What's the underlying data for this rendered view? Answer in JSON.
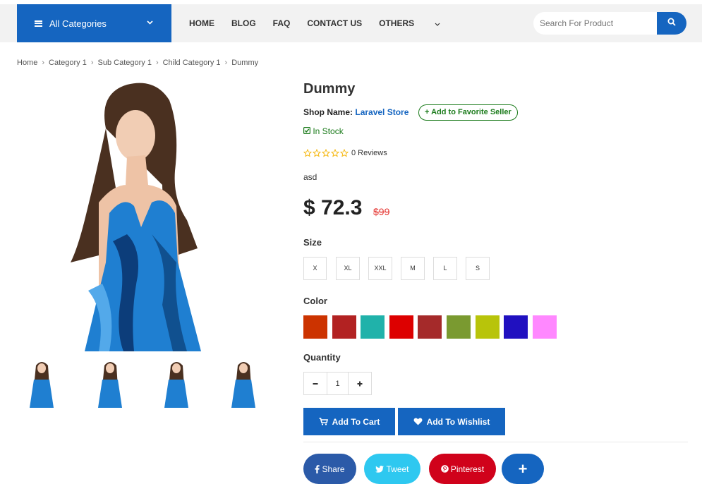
{
  "nav": {
    "all_categories": "All Categories",
    "menu": [
      "HOME",
      "BLOG",
      "FAQ",
      "CONTACT US",
      "OTHERS"
    ],
    "search_placeholder": "Search For Product"
  },
  "breadcrumb": [
    "Home",
    "Category 1",
    "Sub Category 1",
    "Child Category 1",
    "Dummy"
  ],
  "product": {
    "title": "Dummy",
    "shop_label": "Shop Name:",
    "shop_name": "Laravel Store",
    "favorite_label": "Add to Favorite Seller",
    "stock": "In Stock",
    "reviews": "0 Reviews",
    "rating_stars": 0,
    "description": "asd",
    "price": "$ 72.3",
    "old_price": "$99",
    "size_label": "Size",
    "sizes": [
      "X",
      "XL",
      "XXL",
      "M",
      "L",
      "S"
    ],
    "color_label": "Color",
    "colors": [
      "#cc3300",
      "#b22222",
      "#20b2aa",
      "#dd0000",
      "#a52a2a",
      "#7a9a30",
      "#b8c40a",
      "#2010c0",
      "#ff88ff"
    ],
    "quantity_label": "Quantity",
    "quantity": "1",
    "add_to_cart": "Add To Cart",
    "add_to_wishlist": "Add To Wishlist"
  },
  "social": {
    "share": "Share",
    "tweet": "Tweet",
    "pinterest": "Pinterest",
    "more": "+"
  },
  "colors": {
    "primary": "#1565c0",
    "stock_green": "#1b7b1b",
    "facebook": "#2b5aa8",
    "twitter": "#2ec8f0",
    "pinterest": "#d0021b",
    "sale_red": "#e53935"
  }
}
